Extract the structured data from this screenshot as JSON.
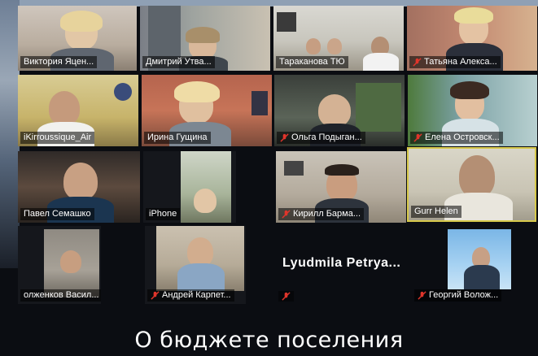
{
  "participants": [
    {
      "name": "Виктория Яцен..."
    },
    {
      "name": "Дмитрий Утва..."
    },
    {
      "name": "Тараканова ТЮ"
    },
    {
      "name": "Татьяна Алекса..."
    },
    {
      "name": "iKirroussique_Air"
    },
    {
      "name": "Ирина Гущина"
    },
    {
      "name": "Ольга Подыган..."
    },
    {
      "name": "Елена Островск..."
    },
    {
      "name": "Павел Семашко"
    },
    {
      "name": "iPhone"
    },
    {
      "name": "Кирилл Барма..."
    },
    {
      "name": "Gurr Helen"
    },
    {
      "name": "олженков Васил..."
    },
    {
      "name": "Андрей Карпет..."
    },
    {
      "name": "Lyudmila  Petrya..."
    },
    {
      "name": "Георгий Волож..."
    }
  ],
  "caption": "О бюджете поселения",
  "icons": {
    "muted_mic": "muted-mic-icon"
  },
  "colors": {
    "muted": "#e0352b",
    "active_speaker": "#d6c84a"
  }
}
